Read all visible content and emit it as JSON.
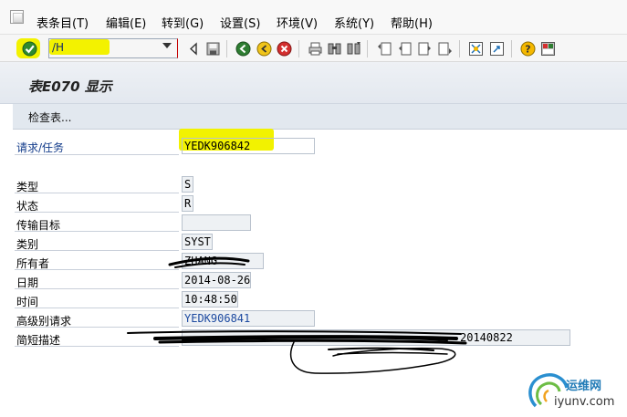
{
  "menu": [
    {
      "label": "表条目(T)"
    },
    {
      "label": "编辑(E)"
    },
    {
      "label": "转到(G)"
    },
    {
      "label": "设置(S)"
    },
    {
      "label": "环境(V)"
    },
    {
      "label": "系统(Y)"
    },
    {
      "label": "帮助(H)"
    }
  ],
  "toolbar": {
    "command_value": "/H",
    "icons": [
      "enter-icon",
      "back-arrow-icon",
      "save-icon",
      "back-icon",
      "exit-icon",
      "cancel-icon",
      "print-icon",
      "find-icon",
      "find-next-icon",
      "first-page-icon",
      "previous-page-icon",
      "next-page-icon",
      "last-page-icon",
      "create-session-icon",
      "shortcut-icon",
      "help-icon",
      "layout-icon"
    ]
  },
  "title": "表E070 显示",
  "app_toolbar": {
    "check_table_label": "检查表..."
  },
  "form": {
    "request_task": {
      "label": "请求/任务",
      "value": "YEDK906842"
    },
    "type": {
      "label": "类型",
      "value": "S"
    },
    "status": {
      "label": "状态",
      "value": "R"
    },
    "target": {
      "label": "传输目标",
      "value": ""
    },
    "category": {
      "label": "类别",
      "value": "SYST"
    },
    "owner": {
      "label": "所有者",
      "value": "ZHANG"
    },
    "date": {
      "label": "日期",
      "value": "2014-08-26"
    },
    "time": {
      "label": "时间",
      "value": "10:48:50"
    },
    "parent_request": {
      "label": "高级别请求",
      "value": "YEDK906841"
    },
    "short_desc": {
      "label": "简短描述",
      "value": "20140822"
    }
  },
  "watermark": {
    "line1": "运维网",
    "line2": "iyunv.com"
  },
  "colors": {
    "highlight": "#f2f200",
    "title_bg": "#e5eaf0",
    "link": "#1d4aa0"
  }
}
